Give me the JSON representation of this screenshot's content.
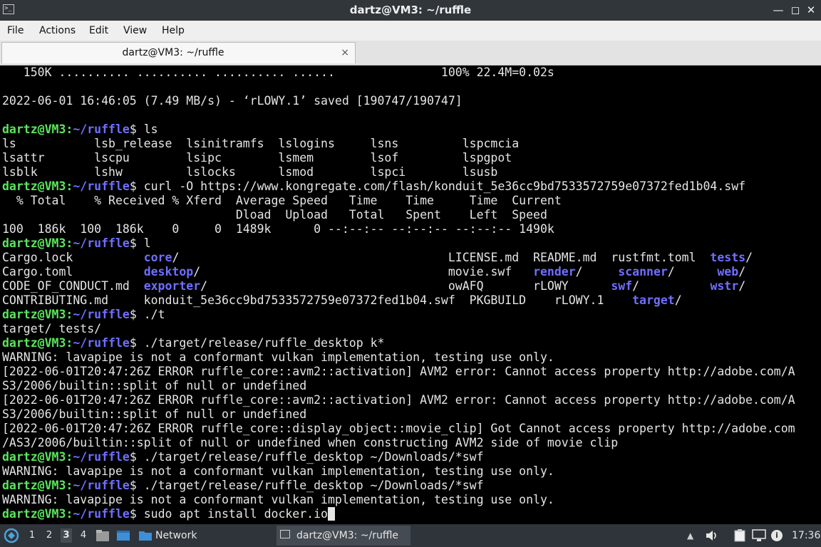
{
  "window": {
    "title": "dartz@VM3: ~/ruffle",
    "terminal_icon_text": ">_",
    "minimize_glyph": "—",
    "maximize_glyph": "◻",
    "close_glyph": "✕"
  },
  "menu": {
    "file": "File",
    "actions": "Actions",
    "edit": "Edit",
    "view": "View",
    "help": "Help"
  },
  "tab": {
    "label": "dartz@VM3: ~/ruffle",
    "close_glyph": "×"
  },
  "terminal": {
    "prompt_user": "dartz@VM3:",
    "prompt_path": "~/ruffle",
    "lines": [
      [
        {
          "t": "   150K .......... .......... .......... ......               100% 22.4M=0.02s"
        }
      ],
      [
        {
          "t": ""
        }
      ],
      [
        {
          "t": "2022-06-01 16:46:05 (7.49 MB/s) - ‘rLOWY.1’ saved [190747/190747]"
        }
      ],
      [
        {
          "t": ""
        }
      ],
      [
        {
          "t": "dartz@VM3:",
          "c": "g"
        },
        {
          "t": "~/ruffle",
          "c": "b"
        },
        {
          "t": "$ ls"
        }
      ],
      [
        {
          "t": "ls           lsb_release  lsinitramfs  lslogins     lsns         lspcmcia"
        }
      ],
      [
        {
          "t": "lsattr       lscpu        lsipc        lsmem        lsof         lspgpot"
        }
      ],
      [
        {
          "t": "lsblk        lshw         lslocks      lsmod        lspci        lsusb"
        }
      ],
      [
        {
          "t": "dartz@VM3:",
          "c": "g"
        },
        {
          "t": "~/ruffle",
          "c": "b"
        },
        {
          "t": "$ curl -O https://www.kongregate.com/flash/konduit_5e36cc9bd7533572759e07372fed1b04.swf"
        }
      ],
      [
        {
          "t": "  % Total    % Received % Xferd  Average Speed   Time    Time     Time  Current"
        }
      ],
      [
        {
          "t": "                                 Dload  Upload   Total   Spent    Left  Speed"
        }
      ],
      [
        {
          "t": "100  186k  100  186k    0     0  1489k      0 --:--:-- --:--:-- --:--:-- 1490k"
        }
      ],
      [
        {
          "t": "dartz@VM3:",
          "c": "g"
        },
        {
          "t": "~/ruffle",
          "c": "b"
        },
        {
          "t": "$ l"
        }
      ],
      [
        {
          "t": "Cargo.lock          "
        },
        {
          "t": "core",
          "c": "b"
        },
        {
          "t": "/                                      LICENSE.md  README.md  rustfmt.toml  "
        },
        {
          "t": "tests",
          "c": "b"
        },
        {
          "t": "/"
        }
      ],
      [
        {
          "t": "Cargo.toml          "
        },
        {
          "t": "desktop",
          "c": "b"
        },
        {
          "t": "/                                   movie.swf   "
        },
        {
          "t": "render",
          "c": "b"
        },
        {
          "t": "/     "
        },
        {
          "t": "scanner",
          "c": "b"
        },
        {
          "t": "/      "
        },
        {
          "t": "web",
          "c": "b"
        },
        {
          "t": "/"
        }
      ],
      [
        {
          "t": "CODE_OF_CONDUCT.md  "
        },
        {
          "t": "exporter",
          "c": "b"
        },
        {
          "t": "/                                  owAFQ       rLOWY      "
        },
        {
          "t": "swf",
          "c": "b"
        },
        {
          "t": "/          "
        },
        {
          "t": "wstr",
          "c": "b"
        },
        {
          "t": "/"
        }
      ],
      [
        {
          "t": "CONTRIBUTING.md     konduit_5e36cc9bd7533572759e07372fed1b04.swf  PKGBUILD    rLOWY.1    "
        },
        {
          "t": "target",
          "c": "b"
        },
        {
          "t": "/"
        }
      ],
      [
        {
          "t": "dartz@VM3:",
          "c": "g"
        },
        {
          "t": "~/ruffle",
          "c": "b"
        },
        {
          "t": "$ ./t"
        }
      ],
      [
        {
          "t": "target/ tests/"
        }
      ],
      [
        {
          "t": "dartz@VM3:",
          "c": "g"
        },
        {
          "t": "~/ruffle",
          "c": "b"
        },
        {
          "t": "$ ./target/release/ruffle_desktop k*"
        }
      ],
      [
        {
          "t": "WARNING: lavapipe is not a conformant vulkan implementation, testing use only."
        }
      ],
      [
        {
          "t": "[2022-06-01T20:47:26Z ERROR ruffle_core::avm2::activation] AVM2 error: Cannot access property http://adobe.com/A"
        }
      ],
      [
        {
          "t": "S3/2006/builtin::split of null or undefined"
        }
      ],
      [
        {
          "t": "[2022-06-01T20:47:26Z ERROR ruffle_core::avm2::activation] AVM2 error: Cannot access property http://adobe.com/A"
        }
      ],
      [
        {
          "t": "S3/2006/builtin::split of null or undefined"
        }
      ],
      [
        {
          "t": "[2022-06-01T20:47:26Z ERROR ruffle_core::display_object::movie_clip] Got Cannot access property http://adobe.com"
        }
      ],
      [
        {
          "t": "/AS3/2006/builtin::split of null or undefined when constructing AVM2 side of movie clip"
        }
      ],
      [
        {
          "t": "dartz@VM3:",
          "c": "g"
        },
        {
          "t": "~/ruffle",
          "c": "b"
        },
        {
          "t": "$ ./target/release/ruffle_desktop ~/Downloads/*swf"
        }
      ],
      [
        {
          "t": "WARNING: lavapipe is not a conformant vulkan implementation, testing use only."
        }
      ],
      [
        {
          "t": "dartz@VM3:",
          "c": "g"
        },
        {
          "t": "~/ruffle",
          "c": "b"
        },
        {
          "t": "$ ./target/release/ruffle_desktop ~/Downloads/*swf"
        }
      ],
      [
        {
          "t": "WARNING: lavapipe is not a conformant vulkan implementation, testing use only."
        }
      ],
      [
        {
          "t": "dartz@VM3:",
          "c": "g"
        },
        {
          "t": "~/ruffle",
          "c": "b"
        },
        {
          "t": "$ sudo apt install docker.io"
        },
        {
          "t": " ",
          "c": "cursor"
        }
      ]
    ]
  },
  "taskbar": {
    "workspaces": [
      "1",
      "2",
      "3",
      "4"
    ],
    "active_workspace": "3",
    "network_label": "Network",
    "window_task_label": "dartz@VM3: ~/ruffle",
    "clock": "17:36",
    "start_icon": "lxqt-logo-icon",
    "up_arrow_glyph": "▲",
    "volume_glyph": "🔈",
    "info_glyph": "i"
  }
}
